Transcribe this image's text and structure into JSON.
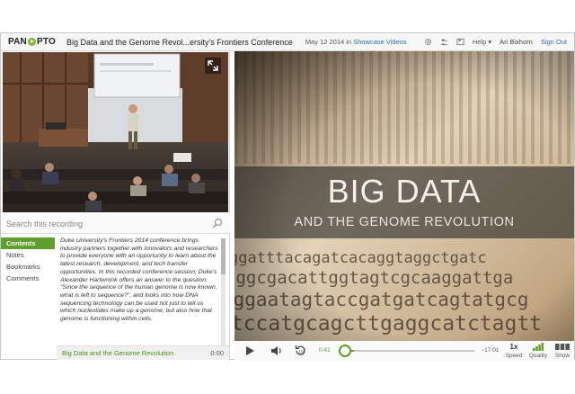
{
  "header": {
    "logo_left": "PAN",
    "logo_right": "PTO",
    "session_title": "Big Data and the Genome Revol...ersity's Frontiers Conference",
    "date_text": "May 12 2014 in ",
    "folder_link": "Showcase Videos",
    "help_label": "Help",
    "user_name": "Ari Bixhorn",
    "sign_out": "Sign Out"
  },
  "search": {
    "placeholder": "Search this recording"
  },
  "tabs": [
    {
      "label": "Contents",
      "active": true
    },
    {
      "label": "Notes",
      "active": false
    },
    {
      "label": "Bookmarks",
      "active": false
    },
    {
      "label": "Comments",
      "active": false
    }
  ],
  "description": "Duke University's Frontiers 2014 conference brings industry partners together with innovators and researchers to provide everyone with an opportunity to learn about the latest research, development, and tech transfer opportunities. In this recorded conference session, Duke's Alexander Hartemink offers an answer to the question: \"Since the sequence of the human genome is now known, what is left to sequence?\", and looks into how DNA sequencing technology can be used not just to tell us which nucleotides make up a genome, but also how that genome is functioning within cells.",
  "chapter": {
    "title": "Big Data and the Genome Revolution",
    "time": "0:00"
  },
  "slide": {
    "title": "BIG DATA",
    "subtitle": "AND THE GENOME REVOLUTION"
  },
  "player": {
    "elapsed": "0:41",
    "remaining": "-17:01",
    "progress_fraction": 0.04,
    "speed_value": "1x",
    "speed_label": "Speed",
    "quality_label": "Quality",
    "show_label": "Show"
  },
  "colors": {
    "accent": "#5f9e2a",
    "link": "#2a6db5"
  },
  "icons": {
    "settings": "gear-icon",
    "users": "users-icon",
    "bookmark": "bookmark-icon",
    "expand": "expand-icon"
  }
}
